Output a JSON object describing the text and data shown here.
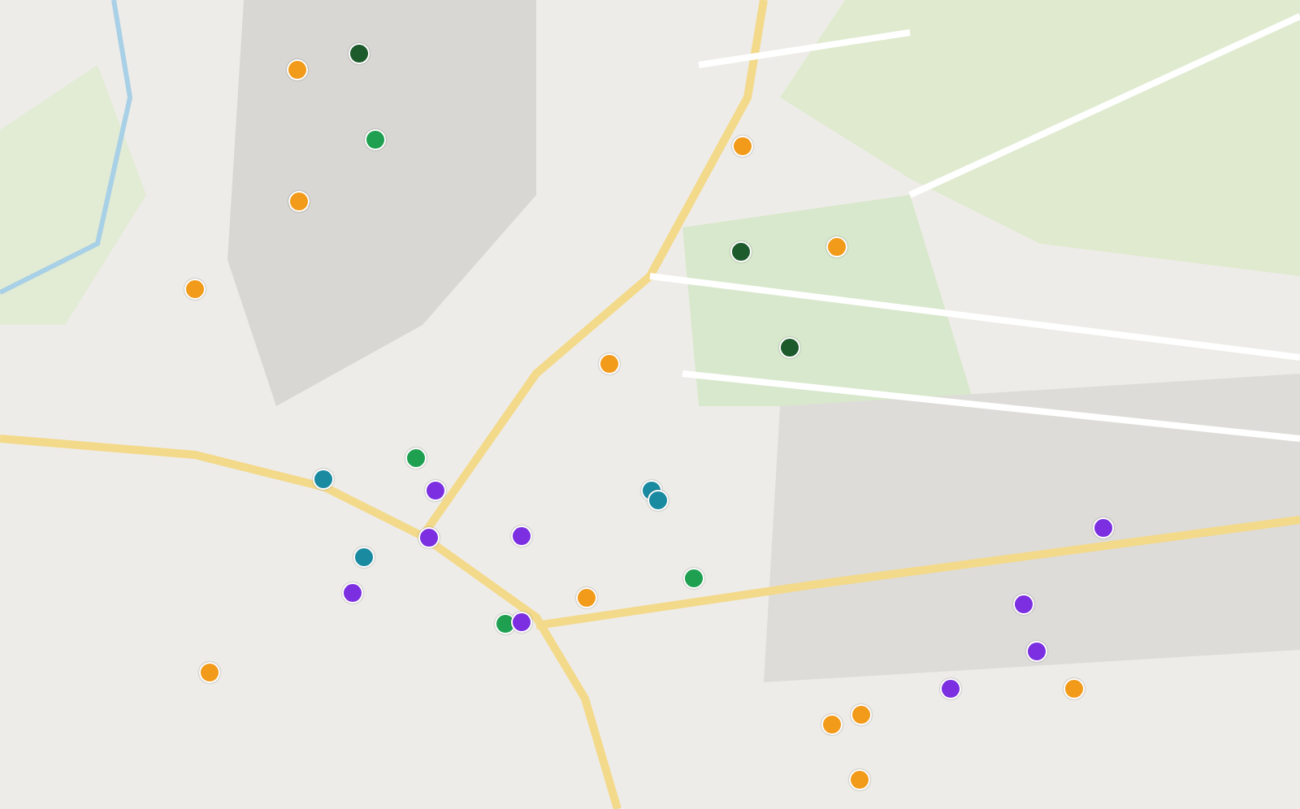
{
  "map": {
    "markers": [
      {
        "color": "#1d5a2c"
      },
      {
        "color": "#f29a1a"
      },
      {
        "color": "#1fa050"
      },
      {
        "color": "#f29a1a"
      },
      {
        "color": "#f29a1a"
      },
      {
        "color": "#f29a1a"
      },
      {
        "color": "#1d5a2c"
      },
      {
        "color": "#f29a1a"
      },
      {
        "color": "#1d5a2c"
      },
      {
        "color": "#f29a1a"
      },
      {
        "color": "#1fa050"
      },
      {
        "color": "#1a8aa0"
      },
      {
        "color": "#7b2fe0"
      },
      {
        "color": "#1a8aa0"
      },
      {
        "color": "#1a8aa0"
      },
      {
        "color": "#7b2fe0"
      },
      {
        "color": "#1a8aa0"
      },
      {
        "color": "#1fa050"
      },
      {
        "color": "#f29a1a"
      },
      {
        "color": "#7b2fe0"
      },
      {
        "color": "#7b2fe0"
      },
      {
        "color": "#7b2fe0"
      },
      {
        "color": "#1fa050"
      },
      {
        "color": "#7b2fe0"
      },
      {
        "color": "#7b2fe0"
      },
      {
        "color": "#7b2fe0"
      },
      {
        "color": "#f29a1a"
      },
      {
        "color": "#f29a1a"
      },
      {
        "color": "#f29a1a"
      },
      {
        "color": "#f29a1a"
      },
      {
        "color": "#f29a1a"
      },
      {
        "color": "#7b2fe0"
      }
    ]
  }
}
